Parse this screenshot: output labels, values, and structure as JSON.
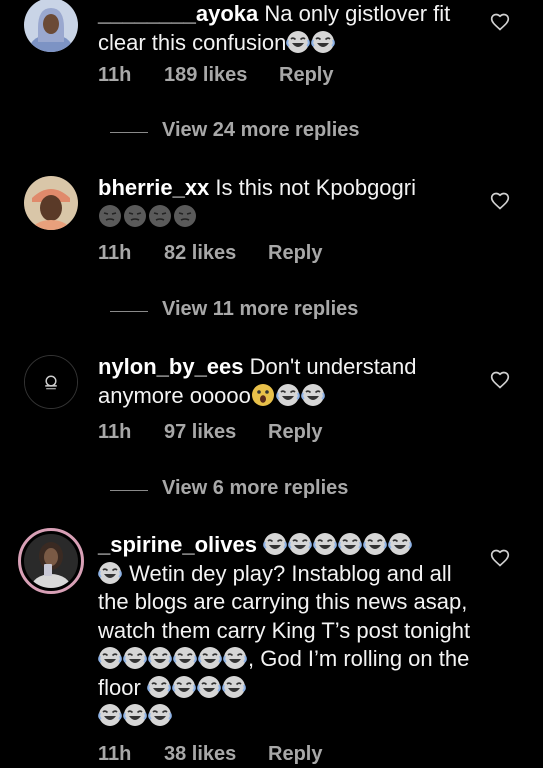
{
  "icons": {
    "heart": "heart-outline-icon",
    "laugh": "face-with-tears-of-joy-emoji",
    "wow": "astonished-face-emoji",
    "smirk": "dark-face-emoji"
  },
  "colors": {
    "background": "#000000",
    "text": "#f2f2f2",
    "muted": "#a8a8a8",
    "story_ring": "#d8a0b6"
  },
  "comments": [
    {
      "username": "________ayoka",
      "text_1": "Na only gistlover fit clear this confusion",
      "time": "11h",
      "likes": "189 likes",
      "reply": "Reply",
      "view_more": "View 24 more replies"
    },
    {
      "username": "bherrie_xx",
      "text_1": "Is this not Kpobgogri",
      "time": "11h",
      "likes": "82 likes",
      "reply": "Reply",
      "view_more": "View 11 more replies"
    },
    {
      "username": "nylon_by_ees",
      "text_1": "Don't understand anymore ooooo",
      "time": "11h",
      "likes": "97 likes",
      "reply": "Reply",
      "view_more": "View 6 more replies"
    },
    {
      "username": "_spirine_olives",
      "text_1": "Wetin dey play? Instablog and all the blogs are carrying this news asap, watch them carry King T’s post tonight",
      "text_2": ", God I’m rolling on the floor",
      "time": "11h",
      "likes": "38 likes",
      "reply": "Reply"
    }
  ]
}
